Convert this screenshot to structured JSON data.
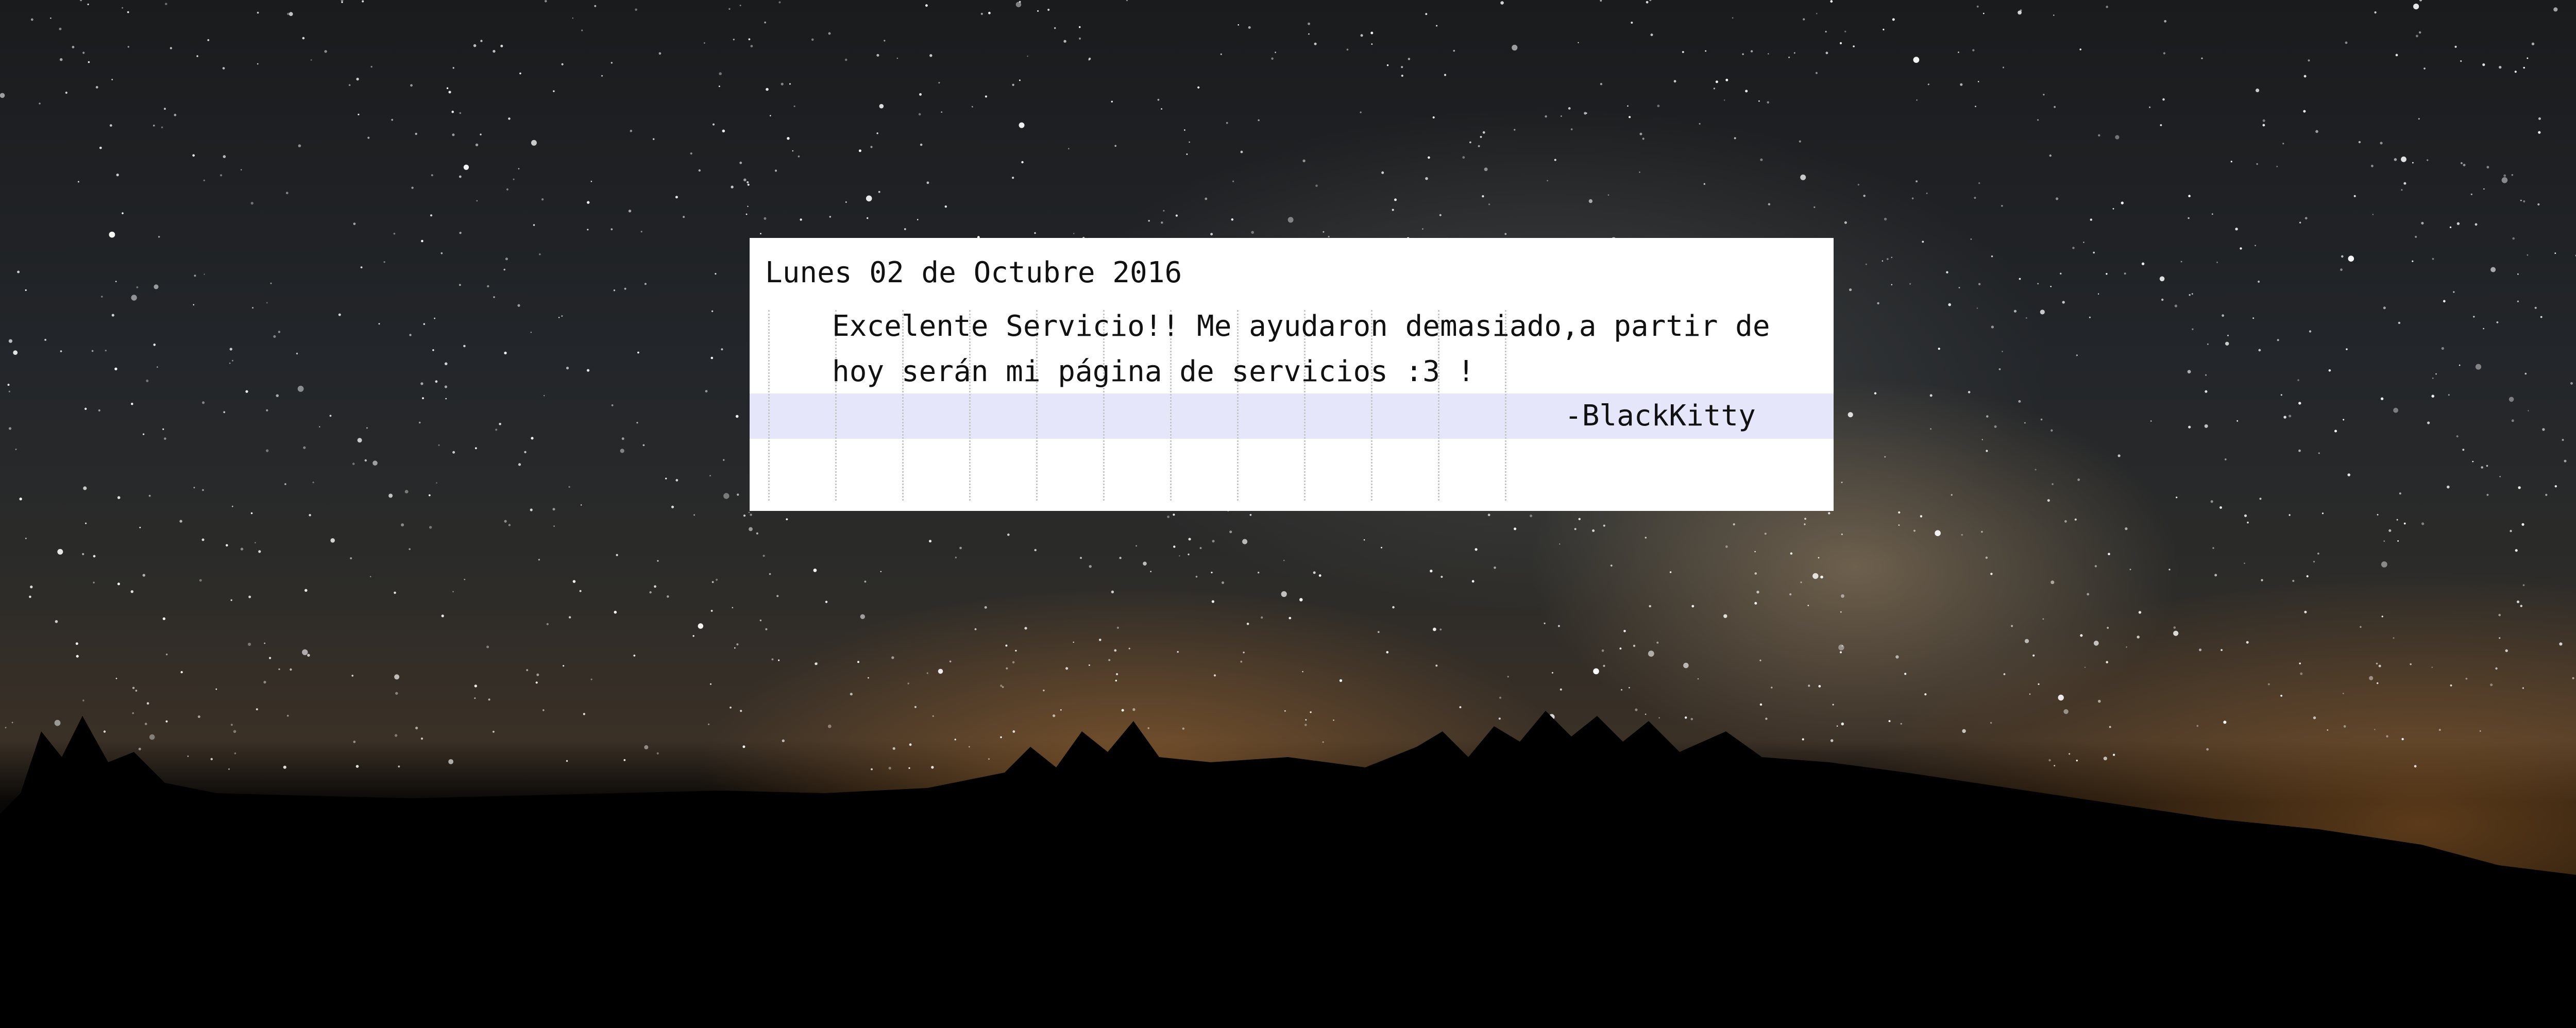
{
  "review": {
    "date": "Lunes 02 de Octubre 2016",
    "message": "Excelente Servicio!! Me ayudaron demasiado,a partir de hoy serán mi página de servicios :3 !",
    "signature": "-BlackKitty"
  },
  "colors": {
    "card_background": "#ffffff",
    "highlight_row": "#e6e6fa",
    "text": "#111111"
  }
}
